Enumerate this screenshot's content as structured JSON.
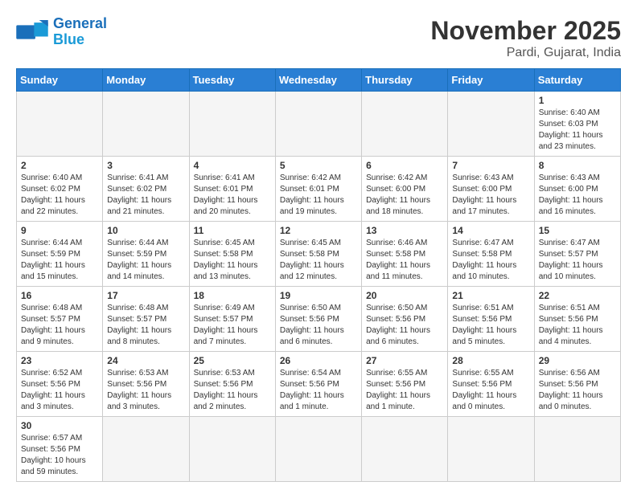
{
  "header": {
    "logo_general": "General",
    "logo_blue": "Blue",
    "month_title": "November 2025",
    "location": "Pardi, Gujarat, India"
  },
  "weekdays": [
    "Sunday",
    "Monday",
    "Tuesday",
    "Wednesday",
    "Thursday",
    "Friday",
    "Saturday"
  ],
  "weeks": [
    [
      {
        "day": "",
        "info": ""
      },
      {
        "day": "",
        "info": ""
      },
      {
        "day": "",
        "info": ""
      },
      {
        "day": "",
        "info": ""
      },
      {
        "day": "",
        "info": ""
      },
      {
        "day": "",
        "info": ""
      },
      {
        "day": "1",
        "info": "Sunrise: 6:40 AM\nSunset: 6:03 PM\nDaylight: 11 hours\nand 23 minutes."
      }
    ],
    [
      {
        "day": "2",
        "info": "Sunrise: 6:40 AM\nSunset: 6:02 PM\nDaylight: 11 hours\nand 22 minutes."
      },
      {
        "day": "3",
        "info": "Sunrise: 6:41 AM\nSunset: 6:02 PM\nDaylight: 11 hours\nand 21 minutes."
      },
      {
        "day": "4",
        "info": "Sunrise: 6:41 AM\nSunset: 6:01 PM\nDaylight: 11 hours\nand 20 minutes."
      },
      {
        "day": "5",
        "info": "Sunrise: 6:42 AM\nSunset: 6:01 PM\nDaylight: 11 hours\nand 19 minutes."
      },
      {
        "day": "6",
        "info": "Sunrise: 6:42 AM\nSunset: 6:00 PM\nDaylight: 11 hours\nand 18 minutes."
      },
      {
        "day": "7",
        "info": "Sunrise: 6:43 AM\nSunset: 6:00 PM\nDaylight: 11 hours\nand 17 minutes."
      },
      {
        "day": "8",
        "info": "Sunrise: 6:43 AM\nSunset: 6:00 PM\nDaylight: 11 hours\nand 16 minutes."
      }
    ],
    [
      {
        "day": "9",
        "info": "Sunrise: 6:44 AM\nSunset: 5:59 PM\nDaylight: 11 hours\nand 15 minutes."
      },
      {
        "day": "10",
        "info": "Sunrise: 6:44 AM\nSunset: 5:59 PM\nDaylight: 11 hours\nand 14 minutes."
      },
      {
        "day": "11",
        "info": "Sunrise: 6:45 AM\nSunset: 5:58 PM\nDaylight: 11 hours\nand 13 minutes."
      },
      {
        "day": "12",
        "info": "Sunrise: 6:45 AM\nSunset: 5:58 PM\nDaylight: 11 hours\nand 12 minutes."
      },
      {
        "day": "13",
        "info": "Sunrise: 6:46 AM\nSunset: 5:58 PM\nDaylight: 11 hours\nand 11 minutes."
      },
      {
        "day": "14",
        "info": "Sunrise: 6:47 AM\nSunset: 5:58 PM\nDaylight: 11 hours\nand 10 minutes."
      },
      {
        "day": "15",
        "info": "Sunrise: 6:47 AM\nSunset: 5:57 PM\nDaylight: 11 hours\nand 10 minutes."
      }
    ],
    [
      {
        "day": "16",
        "info": "Sunrise: 6:48 AM\nSunset: 5:57 PM\nDaylight: 11 hours\nand 9 minutes."
      },
      {
        "day": "17",
        "info": "Sunrise: 6:48 AM\nSunset: 5:57 PM\nDaylight: 11 hours\nand 8 minutes."
      },
      {
        "day": "18",
        "info": "Sunrise: 6:49 AM\nSunset: 5:57 PM\nDaylight: 11 hours\nand 7 minutes."
      },
      {
        "day": "19",
        "info": "Sunrise: 6:50 AM\nSunset: 5:56 PM\nDaylight: 11 hours\nand 6 minutes."
      },
      {
        "day": "20",
        "info": "Sunrise: 6:50 AM\nSunset: 5:56 PM\nDaylight: 11 hours\nand 6 minutes."
      },
      {
        "day": "21",
        "info": "Sunrise: 6:51 AM\nSunset: 5:56 PM\nDaylight: 11 hours\nand 5 minutes."
      },
      {
        "day": "22",
        "info": "Sunrise: 6:51 AM\nSunset: 5:56 PM\nDaylight: 11 hours\nand 4 minutes."
      }
    ],
    [
      {
        "day": "23",
        "info": "Sunrise: 6:52 AM\nSunset: 5:56 PM\nDaylight: 11 hours\nand 3 minutes."
      },
      {
        "day": "24",
        "info": "Sunrise: 6:53 AM\nSunset: 5:56 PM\nDaylight: 11 hours\nand 3 minutes."
      },
      {
        "day": "25",
        "info": "Sunrise: 6:53 AM\nSunset: 5:56 PM\nDaylight: 11 hours\nand 2 minutes."
      },
      {
        "day": "26",
        "info": "Sunrise: 6:54 AM\nSunset: 5:56 PM\nDaylight: 11 hours\nand 1 minute."
      },
      {
        "day": "27",
        "info": "Sunrise: 6:55 AM\nSunset: 5:56 PM\nDaylight: 11 hours\nand 1 minute."
      },
      {
        "day": "28",
        "info": "Sunrise: 6:55 AM\nSunset: 5:56 PM\nDaylight: 11 hours\nand 0 minutes."
      },
      {
        "day": "29",
        "info": "Sunrise: 6:56 AM\nSunset: 5:56 PM\nDaylight: 11 hours\nand 0 minutes."
      }
    ],
    [
      {
        "day": "30",
        "info": "Sunrise: 6:57 AM\nSunset: 5:56 PM\nDaylight: 10 hours\nand 59 minutes."
      },
      {
        "day": "",
        "info": ""
      },
      {
        "day": "",
        "info": ""
      },
      {
        "day": "",
        "info": ""
      },
      {
        "day": "",
        "info": ""
      },
      {
        "day": "",
        "info": ""
      },
      {
        "day": "",
        "info": ""
      }
    ]
  ]
}
